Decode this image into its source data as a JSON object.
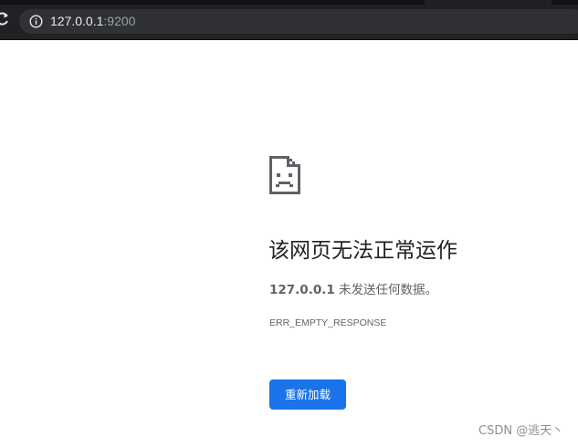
{
  "browser": {
    "address_bar": {
      "host": "127.0.0.1",
      "port": ":9200"
    },
    "icons": {
      "reload": "reload-icon",
      "site_info": "info-icon"
    }
  },
  "error_page": {
    "icon": "sad-page-icon",
    "heading": "该网页无法正常运作",
    "description_host": "127.0.0.1",
    "description_text": " 未发送任何数据。",
    "error_code": "ERR_EMPTY_RESPONSE",
    "reload_button_label": "重新加载"
  },
  "watermark": {
    "text": "CSDN @逃天丶"
  },
  "colors": {
    "toolbar_bg": "#202124",
    "omnibox_bg": "#303134",
    "button_blue": "#1a73e8",
    "heading_text": "#202124",
    "secondary_text": "#5f6368"
  }
}
